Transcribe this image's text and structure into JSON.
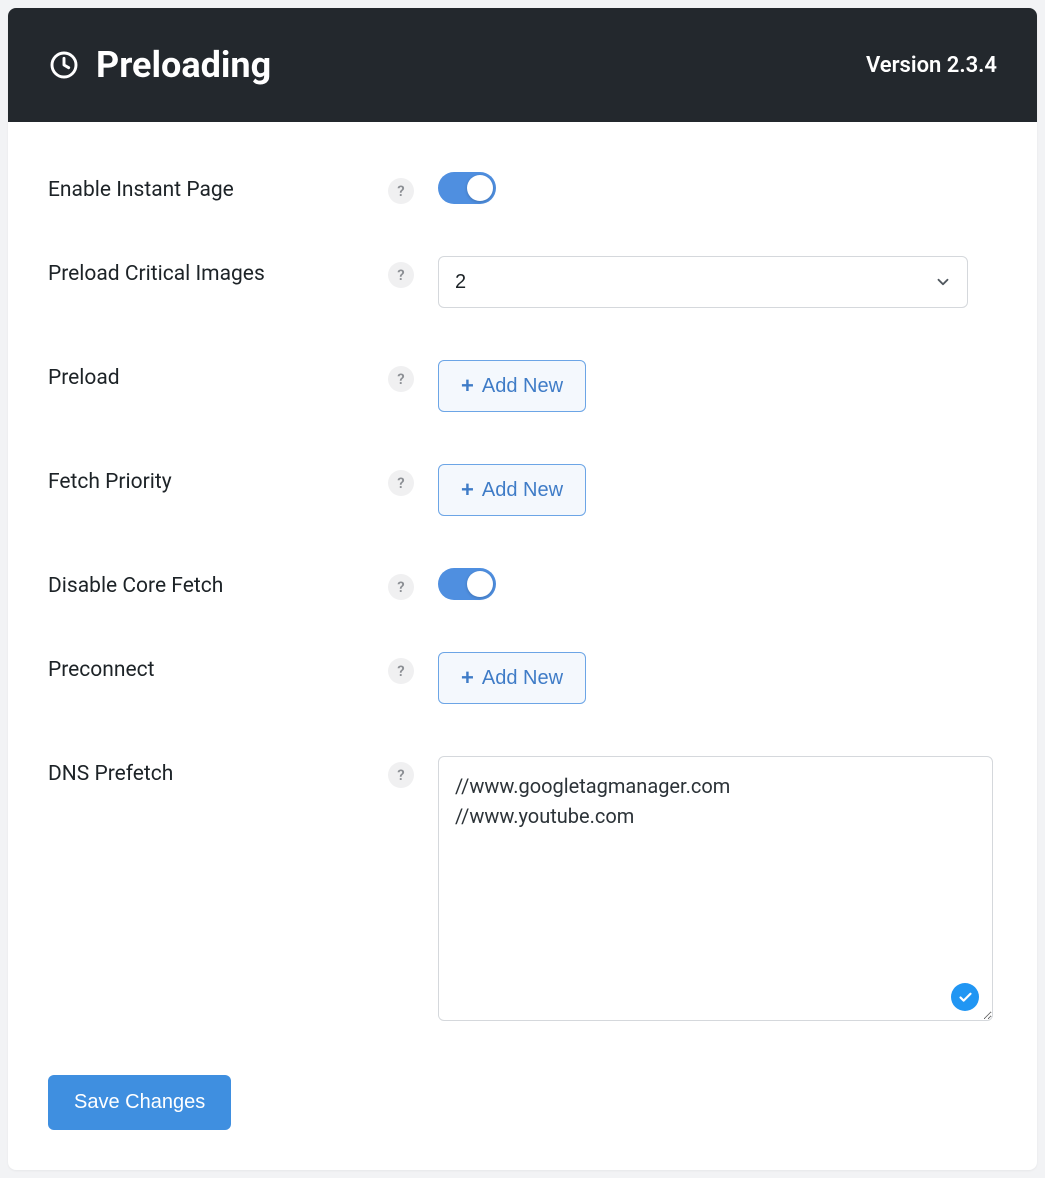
{
  "header": {
    "title": "Preloading",
    "version": "Version 2.3.4"
  },
  "labels": {
    "enable_instant_page": "Enable Instant Page",
    "preload_critical_images": "Preload Critical Images",
    "preload": "Preload",
    "fetch_priority": "Fetch Priority",
    "disable_core_fetch": "Disable Core Fetch",
    "preconnect": "Preconnect",
    "dns_prefetch": "DNS Prefetch"
  },
  "help_glyph": "?",
  "values": {
    "enable_instant_page": true,
    "preload_critical_images": "2",
    "disable_core_fetch": true,
    "dns_prefetch": "//www.googletagmanager.com\n//www.youtube.com"
  },
  "buttons": {
    "add_new": "Add New",
    "save": "Save Changes"
  }
}
